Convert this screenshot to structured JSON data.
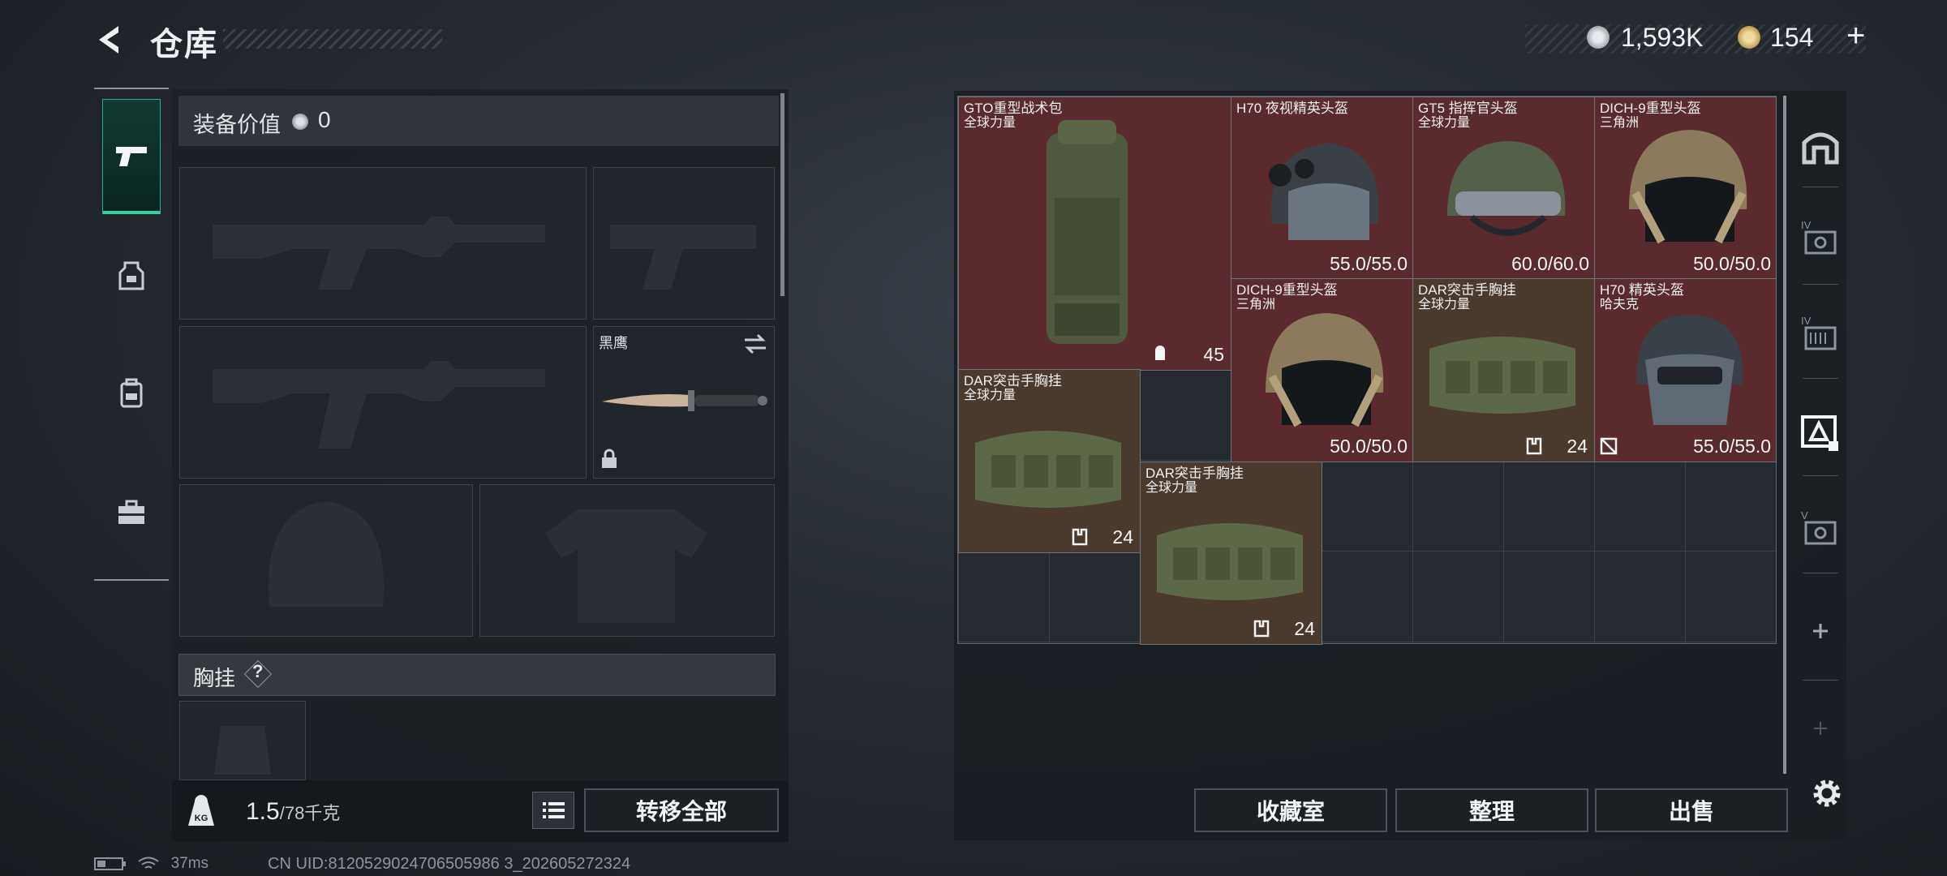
{
  "header": {
    "title": "仓库",
    "money": "1,593K",
    "tickets": "154",
    "plus": "+"
  },
  "left_nav": {
    "items": [
      "pistol-icon",
      "helmet-icon",
      "backpack-icon",
      "toolbox-icon"
    ],
    "active": 0
  },
  "loadout": {
    "value_label": "装备价值",
    "value": "0",
    "melee_name": "黑鹰",
    "chest_rig_label": "胸挂",
    "chest_rig_help": "?",
    "weight": "1.5",
    "weight_cap": "/78千克",
    "transfer_all": "转移全部"
  },
  "stash": {
    "items": [
      {
        "name": "GTO重型战术包",
        "sub": "全球力量",
        "stat": "45",
        "kind": "backpack"
      },
      {
        "name": "H70 夜视精英头盔",
        "sub": "",
        "stat": "55.0/55.0",
        "kind": "helmet"
      },
      {
        "name": "GT5 指挥官头盔",
        "sub": "全球力量",
        "stat": "60.0/60.0",
        "kind": "helmet"
      },
      {
        "name": "DICH-9重型头盔",
        "sub": "三角洲",
        "stat": "50.0/50.0",
        "kind": "helmet"
      },
      {
        "name": "DICH-9重型头盔",
        "sub": "三角洲",
        "stat": "50.0/50.0",
        "kind": "helmet"
      },
      {
        "name": "DAR突击手胸挂",
        "sub": "全球力量",
        "stat": "24",
        "kind": "rig"
      },
      {
        "name": "H70 精英头盔",
        "sub": "哈夫克",
        "stat": "55.0/55.0",
        "kind": "helmet"
      },
      {
        "name": "DAR突击手胸挂",
        "sub": "全球力量",
        "stat": "24",
        "kind": "rig"
      },
      {
        "name": "DAR突击手胸挂",
        "sub": "全球力量",
        "stat": "24",
        "kind": "rig"
      }
    ]
  },
  "actions": {
    "collection": "收藏室",
    "sort": "整理",
    "sell": "出售"
  },
  "status": {
    "ping": "37ms",
    "uid": "CN UID:8120529024706505986 3_202605272324"
  },
  "colors": {
    "accent": "#33d29e",
    "item_red": "#5b2a2e",
    "item_brown": "#4a3a2e"
  }
}
